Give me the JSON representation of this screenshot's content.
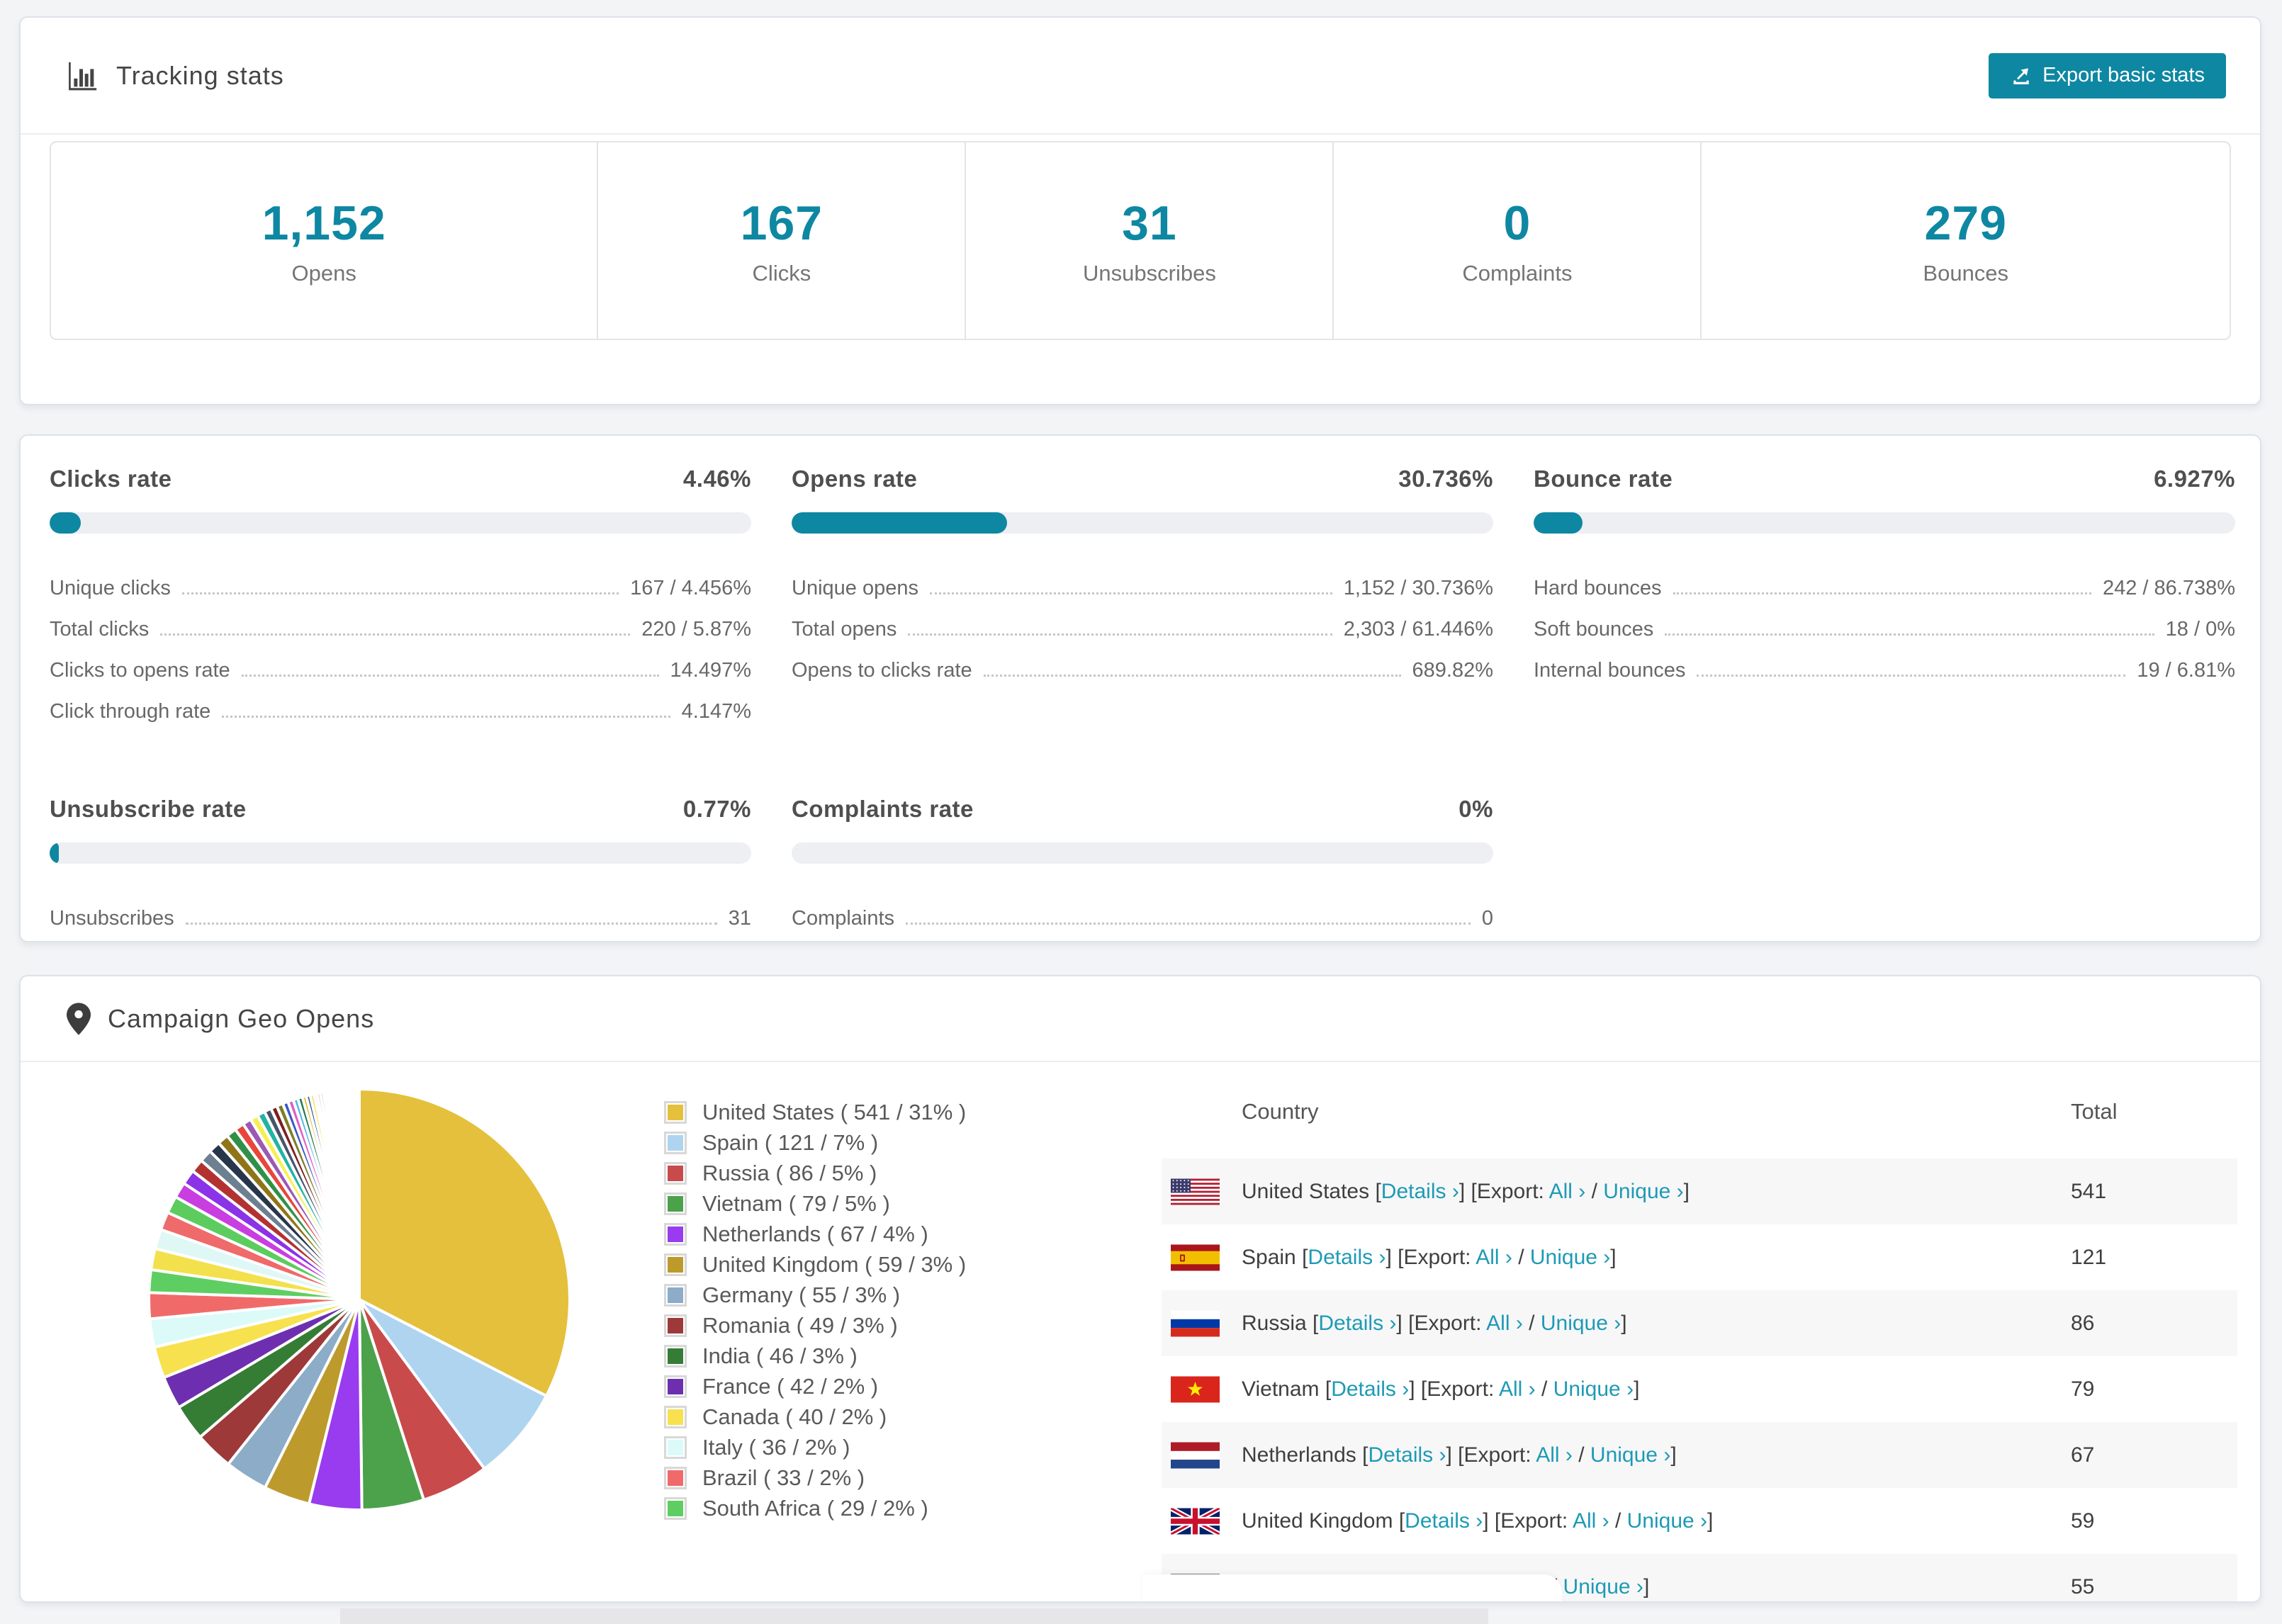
{
  "header": {
    "title": "Tracking stats",
    "export_button_label": "Export basic stats"
  },
  "summary_stats": [
    {
      "value": "1,152",
      "label": "Opens"
    },
    {
      "value": "167",
      "label": "Clicks"
    },
    {
      "value": "31",
      "label": "Unsubscribes"
    },
    {
      "value": "0",
      "label": "Complaints"
    },
    {
      "value": "279",
      "label": "Bounces"
    }
  ],
  "rate_sections": [
    {
      "title": "Clicks rate",
      "rate": "4.46%",
      "bar_pct": 4.46,
      "rows": [
        {
          "label": "Unique clicks",
          "value": "167 / 4.456%"
        },
        {
          "label": "Total clicks",
          "value": "220 / 5.87%"
        },
        {
          "label": "Clicks to opens rate",
          "value": "14.497%"
        },
        {
          "label": "Click through rate",
          "value": "4.147%"
        }
      ]
    },
    {
      "title": "Opens rate",
      "rate": "30.736%",
      "bar_pct": 30.736,
      "rows": [
        {
          "label": "Unique opens",
          "value": "1,152 / 30.736%"
        },
        {
          "label": "Total opens",
          "value": "2,303 / 61.446%"
        },
        {
          "label": "Opens to clicks rate",
          "value": "689.82%"
        }
      ]
    },
    {
      "title": "Bounce rate",
      "rate": "6.927%",
      "bar_pct": 6.927,
      "rows": [
        {
          "label": "Hard bounces",
          "value": "242 / 86.738%"
        },
        {
          "label": "Soft bounces",
          "value": "18 / 0%"
        },
        {
          "label": "Internal bounces",
          "value": "19 / 6.81%"
        }
      ]
    },
    {
      "title": "Unsubscribe rate",
      "rate": "0.77%",
      "bar_pct": 0.77,
      "rows": [
        {
          "label": "Unsubscribes",
          "value": "31"
        }
      ]
    },
    {
      "title": "Complaints rate",
      "rate": "0%",
      "bar_pct": 0,
      "rows": [
        {
          "label": "Complaints",
          "value": "0"
        }
      ]
    }
  ],
  "geo": {
    "title": "Campaign Geo Opens",
    "table": {
      "columns": {
        "country": "Country",
        "total": "Total"
      },
      "link_labels": {
        "details": "Details ›",
        "export_prefix": "Export:",
        "all": "All ›",
        "unique": "Unique ›"
      },
      "rows": [
        {
          "country": "United States",
          "flag": "us",
          "total": "541"
        },
        {
          "country": "Spain",
          "flag": "es",
          "total": "121"
        },
        {
          "country": "Russia",
          "flag": "ru",
          "total": "86"
        },
        {
          "country": "Vietnam",
          "flag": "vn",
          "total": "79"
        },
        {
          "country": "Netherlands",
          "flag": "nl",
          "total": "67"
        },
        {
          "country": "United Kingdom",
          "flag": "gb",
          "total": "59"
        },
        {
          "country": "Germany",
          "flag": "de",
          "total": "55"
        }
      ]
    }
  },
  "chart_data": {
    "type": "pie",
    "title": "Campaign Geo Opens",
    "unit": "opens",
    "legend_position": "right-of-pie",
    "start_angle_deg": 0,
    "direction": "clockwise",
    "series": [
      {
        "name": "United States",
        "value": 541,
        "pct": 31,
        "color": "#e4c03c"
      },
      {
        "name": "Spain",
        "value": 121,
        "pct": 7,
        "color": "#aed4f0"
      },
      {
        "name": "Russia",
        "value": 86,
        "pct": 5,
        "color": "#c94a4a"
      },
      {
        "name": "Vietnam",
        "value": 79,
        "pct": 5,
        "color": "#4ba24b"
      },
      {
        "name": "Netherlands",
        "value": 67,
        "pct": 4,
        "color": "#993bef"
      },
      {
        "name": "United Kingdom",
        "value": 59,
        "pct": 3,
        "color": "#bd9a2c"
      },
      {
        "name": "Germany",
        "value": 55,
        "pct": 3,
        "color": "#8cacc8"
      },
      {
        "name": "Romania",
        "value": 49,
        "pct": 3,
        "color": "#9e3939"
      },
      {
        "name": "India",
        "value": 46,
        "pct": 3,
        "color": "#357d35"
      },
      {
        "name": "France",
        "value": 42,
        "pct": 2,
        "color": "#6d2fb0"
      },
      {
        "name": "Canada",
        "value": 40,
        "pct": 2,
        "color": "#f7e14e"
      },
      {
        "name": "Italy",
        "value": 36,
        "pct": 2,
        "color": "#dcfbf8"
      },
      {
        "name": "Brazil",
        "value": 33,
        "pct": 2,
        "color": "#f16a6a"
      },
      {
        "name": "South Africa",
        "value": 29,
        "pct": 2,
        "color": "#5fce62"
      }
    ],
    "others_tail": {
      "note": "many small unlabeled country slices",
      "values": [
        27,
        25,
        23,
        22,
        20,
        19,
        17,
        16,
        15,
        14,
        13,
        12,
        11,
        10,
        10,
        9,
        8,
        8,
        7,
        7,
        6,
        6,
        5,
        5,
        5,
        4,
        4,
        4,
        3,
        3,
        3,
        3,
        2,
        2,
        2,
        2,
        2,
        2,
        2,
        1.5,
        1.5,
        1.5,
        1.5,
        1,
        1,
        1,
        1,
        1,
        1,
        1,
        0.8,
        0.8,
        0.8,
        0.8,
        0.6,
        0.6,
        0.6,
        0.5,
        0.5,
        0.5
      ]
    }
  },
  "colors": {
    "accent_teal": "#0e87a2",
    "link_teal": "#1e9ab5",
    "bar_track": "#edeff2"
  }
}
